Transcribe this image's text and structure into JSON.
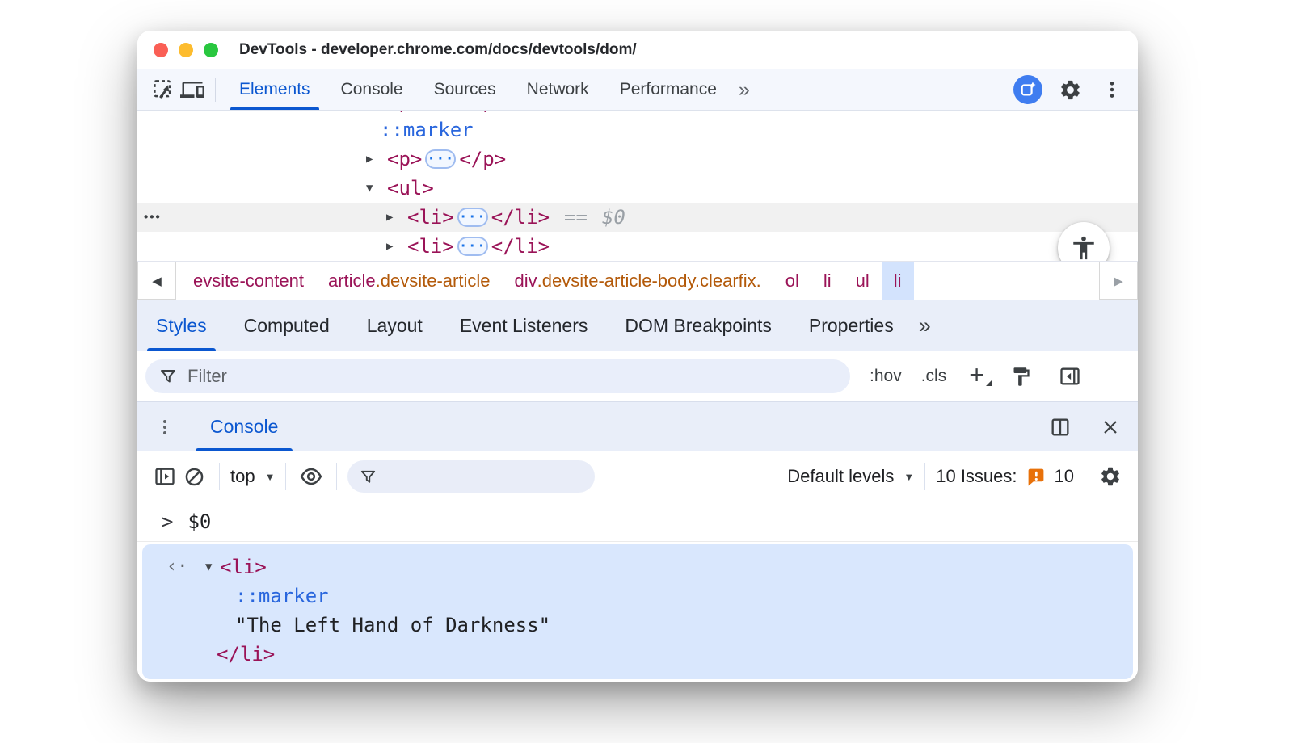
{
  "window": {
    "title": "DevTools - developer.chrome.com/docs/devtools/dom/"
  },
  "colors": {
    "accent_blue": "#0b57d0",
    "pseudo_blue": "#2966dd",
    "tag_maroon": "#9a1357",
    "class_orange": "#b35909",
    "issues_orange": "#e8710a",
    "selected_crumb_bg": "#d3e3fd",
    "result_highlight_bg": "#d9e7fd",
    "strip_bg": "#e9eef9"
  },
  "toolbar": {
    "tabs": [
      {
        "label": "Elements"
      },
      {
        "label": "Console"
      },
      {
        "label": "Sources"
      },
      {
        "label": "Network"
      },
      {
        "label": "Performance"
      }
    ],
    "more_label": "»"
  },
  "dom_tree": {
    "rows": [
      {
        "pseudo": "::marker"
      },
      {
        "arrow": "▶",
        "open_tag": "<p>",
        "ellipsis": "···",
        "close_tag": "</p>"
      },
      {
        "arrow": "▼",
        "open_tag": "<ul>"
      },
      {
        "arrow": "▶",
        "open_tag": "<li>",
        "ellipsis": "···",
        "close_tag": "</li>",
        "equals": "==",
        "retval": "$0",
        "more_dots": "•••"
      },
      {
        "arrow": "▶",
        "open_tag": "<li>",
        "ellipsis": "···",
        "close_tag": "</li>"
      }
    ]
  },
  "breadcrumb": {
    "prev": "◀",
    "next": "▶",
    "items": [
      {
        "tag": "evsite-content",
        "cls": ""
      },
      {
        "tag": "article",
        "cls": ".devsite-article"
      },
      {
        "tag": "div",
        "cls": ".devsite-article-body.clearfix."
      },
      {
        "tag": "ol",
        "cls": ""
      },
      {
        "tag": "li",
        "cls": ""
      },
      {
        "tag": "ul",
        "cls": ""
      },
      {
        "tag": "li",
        "cls": ""
      }
    ]
  },
  "styles_panel": {
    "tabs": [
      {
        "label": "Styles"
      },
      {
        "label": "Computed"
      },
      {
        "label": "Layout"
      },
      {
        "label": "Event Listeners"
      },
      {
        "label": "DOM Breakpoints"
      },
      {
        "label": "Properties"
      }
    ],
    "more_label": "»",
    "filter_placeholder": "Filter",
    "pseudo_toggle": ":hov",
    "class_toggle": ".cls",
    "add_label": "+"
  },
  "drawer": {
    "tab_label": "Console"
  },
  "console": {
    "context": "top",
    "caret": "▼",
    "levels_label": "Default levels",
    "issues_label": "10 Issues:",
    "issues_count": "10",
    "prompt": ">",
    "command": "$0",
    "result": {
      "return_marker": "‹·",
      "arrow": "▼",
      "open_tag": "<li>",
      "pseudo": "::marker",
      "string": "\"The Left Hand of Darkness\"",
      "close_tag": "</li>"
    }
  }
}
